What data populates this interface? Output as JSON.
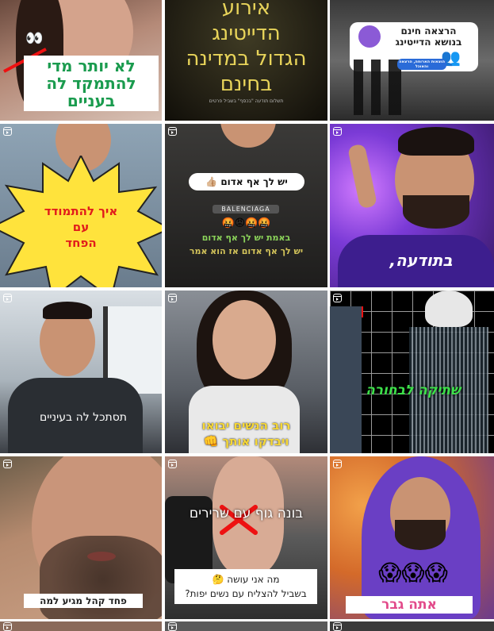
{
  "grid": {
    "tiles": [
      {
        "caption_line1": "לא יותר מדי",
        "caption_line2": "להתמקד לה בעניים"
      },
      {
        "caption_line1": "אירוע",
        "caption_line2": "הדייטינג",
        "caption_line3": "הגדול במדינה",
        "caption_line4": "בחינם",
        "sub": "תשלום תודעה \"בכסף\" בשביל פרטים"
      },
      {
        "caption_line1": "הרצאה חינם",
        "caption_line2": "בנושא הדייטינג",
        "sub": "הוצאות הארוחה, הרצאה והאוכל"
      },
      {
        "caption_line1": "איך להתמודד",
        "caption_line2": "עם",
        "caption_line3": "הפחד"
      },
      {
        "pill": "יש לך אף אדום 👍🏼",
        "brand": "BALENCIAGA",
        "emojis": "🤬🤬😡🤬",
        "line1": "באמת יש לך אף אדום",
        "line2": "יש לך אף אדום אז הוא אמר"
      },
      {
        "shirt": "בתודעה,"
      },
      {
        "caption": "תסתכל לה בעיניים"
      },
      {
        "caption_line1": "רוב הנשים יבואו",
        "caption_line2": "ויבדקו אותך 👊"
      },
      {
        "caption": "שתיקה לבחורה"
      },
      {
        "caption": "פחד קהל מגיע למה"
      },
      {
        "caption_top": "בונה גוף עם שרירים",
        "caption_line1": "מה אני עושה 🤔",
        "caption_line2": "בשביל להצליח עם נשים יפות?"
      },
      {
        "emojis": "😱😱😱",
        "caption": "אתה גבר"
      }
    ]
  },
  "colors": {
    "green": "#1a9b4e",
    "yellow": "#ffe33c",
    "purple": "#4a2aa8"
  }
}
